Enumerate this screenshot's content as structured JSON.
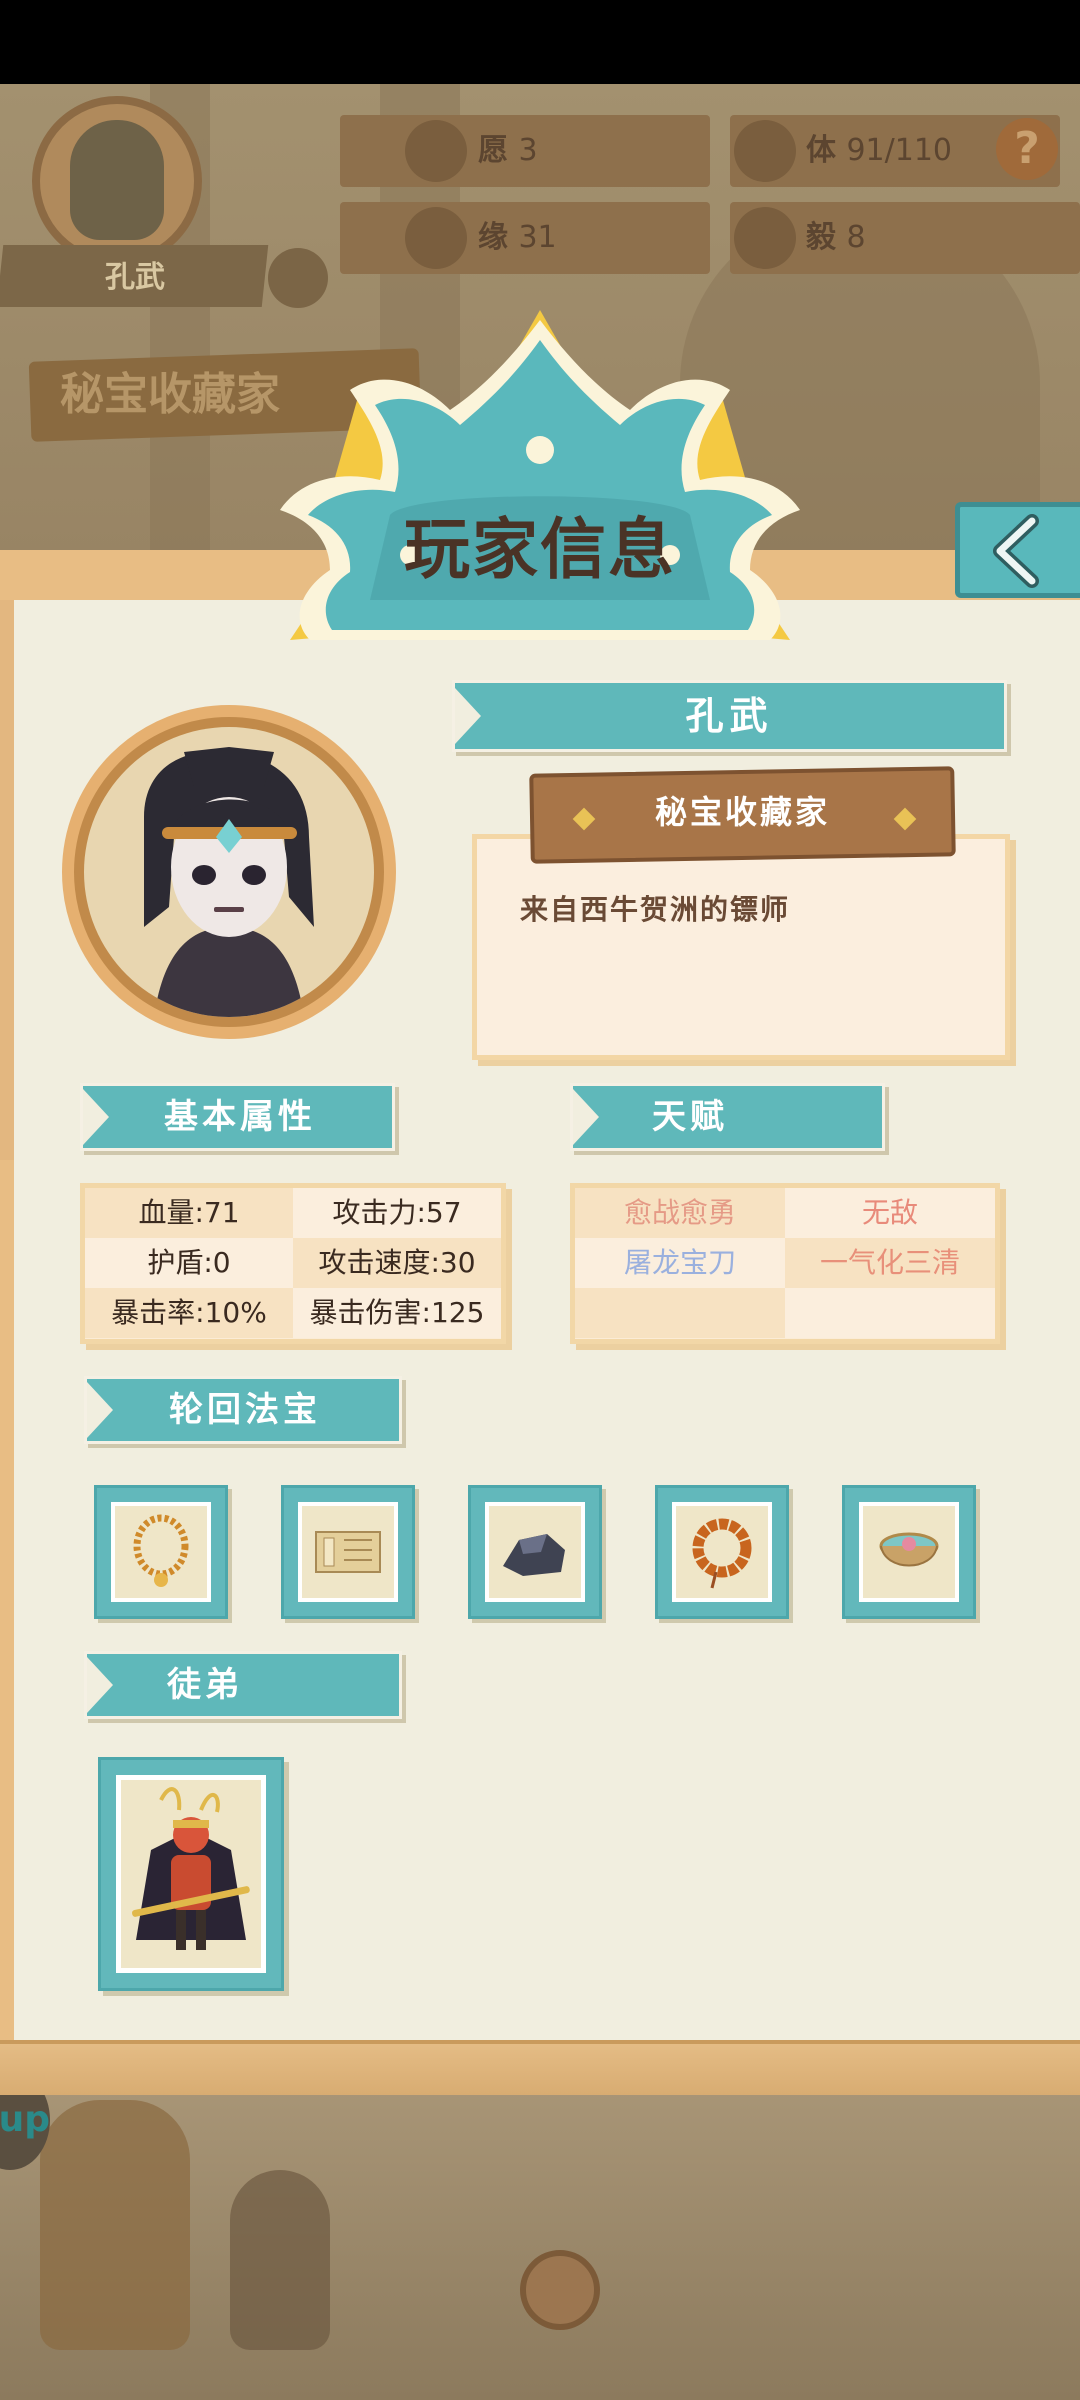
{
  "header": {
    "player_name": "孔武",
    "bg_title": "秘宝收藏家",
    "stats": [
      {
        "icon": "wish-icon",
        "label": "愿",
        "value": "3"
      },
      {
        "icon": "stamina-icon",
        "label": "体",
        "value": "91/110"
      },
      {
        "icon": "fate-icon",
        "label": "缘",
        "value": "31"
      },
      {
        "icon": "resolve-icon",
        "label": "毅",
        "value": "8"
      }
    ],
    "help": "?"
  },
  "panel": {
    "title": "玩家信息",
    "name": "孔武",
    "player_title": "秘宝收藏家",
    "description": "来自西牛贺洲的镖师"
  },
  "sections": {
    "basic": "基本属性",
    "talent": "天赋",
    "treasure": "轮回法宝",
    "disciple": "徒弟"
  },
  "basic_stats": [
    [
      "血量:71",
      "攻击力:57"
    ],
    [
      "护盾:0",
      "攻击速度:30"
    ],
    [
      "暴击率:10%",
      "暴击伤害:125"
    ]
  ],
  "talents": [
    [
      "愈战愈勇",
      "无敌"
    ],
    [
      "屠龙宝刀",
      "一气化三清"
    ],
    [
      "",
      ""
    ]
  ],
  "talent_colors": {
    "愈战愈勇": "#e59a86",
    "无敌": "#e88a7a",
    "屠龙宝刀": "#9ab0de",
    "一气化三清": "#e8907a"
  },
  "treasures": [
    "amber-necklace-icon",
    "scroll-book-icon",
    "black-stone-icon",
    "prayer-beads-icon",
    "jade-bowl-icon"
  ],
  "disciples": [
    "monkey-king-icon"
  ],
  "bottom": {
    "up_badge": "up"
  },
  "colors": {
    "teal": "#5fb8ba",
    "panel": "#f1eedf",
    "wood": "#a87548",
    "gold": "#e9c256"
  }
}
